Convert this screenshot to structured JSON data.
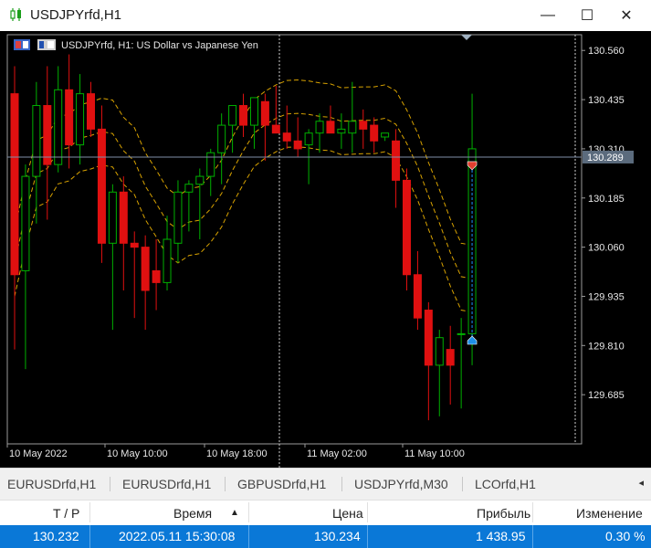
{
  "window": {
    "title": "USDJPYrfd,H1",
    "minimize_glyph": "—",
    "maximize_glyph": "☐",
    "close_glyph": "✕"
  },
  "chart": {
    "label": "USDJPYrfd, H1:  US Dollar vs Japanese Yen",
    "price_labels": [
      "130.560",
      "130.435",
      "130.310",
      "130.185",
      "130.060",
      "129.935",
      "129.810",
      "129.685"
    ],
    "current_price": "130.289",
    "time_labels": [
      "10 May 2022",
      "10 May 10:00",
      "10 May 18:00",
      "11 May 02:00",
      "11 May 10:00"
    ],
    "colors": {
      "background": "#000000",
      "bull": "#00b000",
      "bear": "#e01010",
      "bands": "#d9a300",
      "grid": "#9a9a9a",
      "bid_line": "#7f8fa8",
      "trade_line": "#1e90ff"
    }
  },
  "chart_data": {
    "type": "candlestick",
    "symbol": "USDJPYrfd",
    "timeframe": "H1",
    "ylim": [
      129.56,
      130.6
    ],
    "ohlc": [
      [
        130.45,
        130.52,
        129.8,
        129.99
      ],
      [
        130.0,
        130.27,
        129.75,
        130.24
      ],
      [
        130.24,
        130.48,
        130.12,
        130.42
      ],
      [
        130.42,
        130.52,
        130.13,
        130.27
      ],
      [
        130.27,
        130.52,
        130.25,
        130.46
      ],
      [
        130.46,
        130.55,
        130.26,
        130.32
      ],
      [
        130.32,
        130.5,
        130.27,
        130.45
      ],
      [
        130.45,
        130.48,
        130.34,
        130.36
      ],
      [
        130.36,
        130.42,
        130.02,
        130.07
      ],
      [
        130.07,
        130.22,
        129.85,
        130.2
      ],
      [
        130.2,
        130.24,
        129.95,
        130.07
      ],
      [
        130.07,
        130.1,
        129.88,
        130.06
      ],
      [
        130.06,
        130.09,
        129.85,
        129.95
      ],
      [
        130.0,
        130.08,
        129.9,
        129.97
      ],
      [
        129.97,
        130.14,
        129.95,
        130.08
      ],
      [
        130.07,
        130.23,
        130.02,
        130.2
      ],
      [
        130.2,
        130.23,
        130.1,
        130.22
      ],
      [
        130.22,
        130.26,
        130.08,
        130.24
      ],
      [
        130.24,
        130.31,
        130.19,
        130.3
      ],
      [
        130.3,
        130.4,
        130.22,
        130.37
      ],
      [
        130.37,
        130.42,
        130.3,
        130.42
      ],
      [
        130.42,
        130.45,
        130.34,
        130.37
      ],
      [
        130.37,
        130.44,
        130.31,
        130.44
      ],
      [
        130.43,
        130.45,
        130.28,
        130.37
      ],
      [
        130.37,
        130.47,
        130.35,
        130.35
      ],
      [
        130.35,
        130.42,
        130.31,
        130.33
      ],
      [
        130.33,
        130.39,
        130.29,
        130.31
      ],
      [
        130.32,
        130.36,
        130.22,
        130.35
      ],
      [
        130.35,
        130.4,
        130.3,
        130.38
      ],
      [
        130.38,
        130.42,
        130.35,
        130.35
      ],
      [
        130.35,
        130.4,
        130.31,
        130.36
      ],
      [
        130.35,
        130.48,
        130.3,
        130.38
      ],
      [
        130.38,
        130.41,
        130.31,
        130.36
      ],
      [
        130.37,
        130.39,
        130.3,
        130.33
      ],
      [
        130.34,
        130.35,
        130.33,
        130.35
      ],
      [
        130.33,
        130.36,
        130.16,
        130.23
      ],
      [
        130.23,
        130.26,
        129.95,
        129.99
      ],
      [
        129.99,
        130.05,
        129.85,
        129.88
      ],
      [
        129.9,
        129.92,
        129.62,
        129.76
      ],
      [
        129.76,
        129.85,
        129.63,
        129.83
      ],
      [
        129.8,
        129.86,
        129.66,
        129.76
      ],
      [
        129.84,
        129.88,
        129.65,
        129.84
      ],
      [
        129.84,
        130.45,
        129.76,
        130.31
      ]
    ],
    "current_price": 130.289,
    "trade_open_price": 129.82
  },
  "tabs": [
    "EURUSDrfd,H1",
    "EURUSDrfd,H1",
    "GBPUSDrfd,H1",
    "USDJPYrfd,M30",
    "LCOrfd,H1"
  ],
  "tabs_scroll_glyph": "◂",
  "table": {
    "headers": [
      "T / P",
      "Время",
      "Цена",
      "Прибыль",
      "Изменение"
    ],
    "sort_glyph": "▲",
    "row": {
      "tp": "130.232",
      "time": "2022.05.11 15:30:08",
      "price": "130.234",
      "profit": "1 438.95",
      "change": "0.30 %"
    }
  }
}
